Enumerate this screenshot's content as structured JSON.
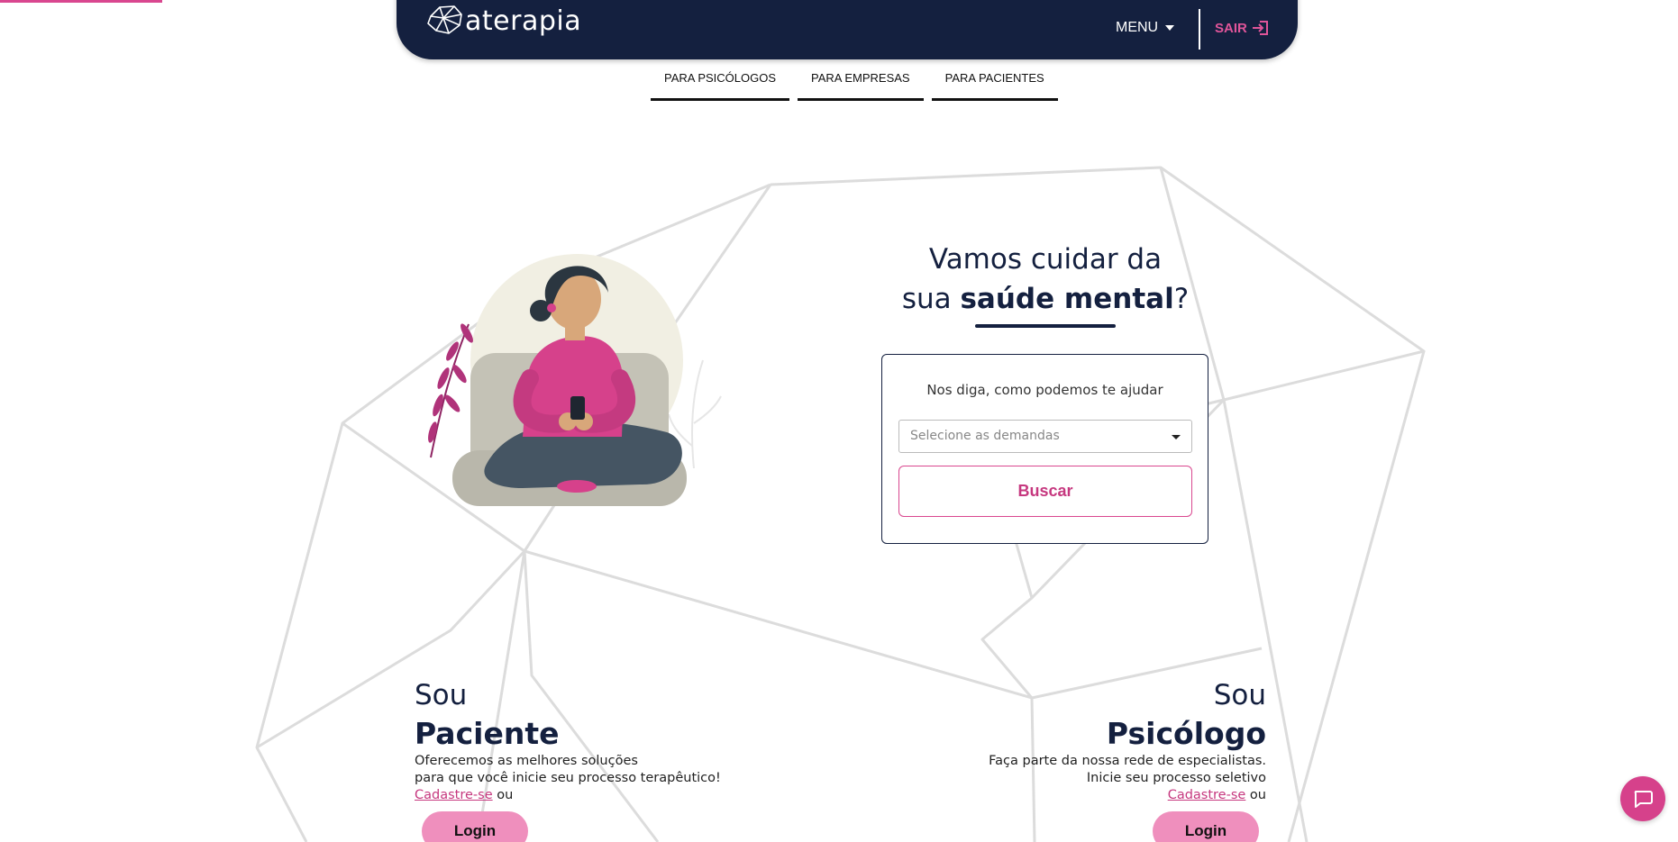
{
  "header": {
    "logo_text": "aterapia",
    "menu_label": "MENU",
    "logout_label": "SAIR"
  },
  "tabs": [
    {
      "label": "PARA PSICÓLOGOS"
    },
    {
      "label": "PARA EMPRESAS"
    },
    {
      "label": "PARA PACIENTES"
    }
  ],
  "hero": {
    "title_line1": "Vamos cuidar da",
    "title_line2_prefix": "sua ",
    "title_line2_bold": "saúde mental",
    "title_line2_suffix": "?"
  },
  "search": {
    "prompt": "Nos diga, como podemos te ajudar",
    "select_placeholder": "Selecione as demandas",
    "button_label": "Buscar"
  },
  "paciente": {
    "sou": "Sou",
    "role": "Paciente",
    "desc_line1": "Oferecemos as melhores soluções",
    "desc_line2": "para que você inicie seu processo terapêutico!",
    "signup_link": "Cadastre-se",
    "or_text": " ou",
    "login_label": "Login"
  },
  "psicologo": {
    "sou": "Sou",
    "role": "Psicólogo",
    "desc_line1": "Faça parte da nossa rede de especialistas.",
    "desc_line2": "Inicie seu processo seletivo",
    "signup_link": "Cadastre-se",
    "or_text": " ou",
    "login_label": "Login"
  },
  "colors": {
    "navy": "#14203f",
    "pink": "#d9478f",
    "pink_light": "#ef8fbd"
  },
  "icons": {
    "logo": "geometric-brain-logo-icon",
    "menu": "caret-down-icon",
    "logout": "sign-out-icon",
    "chat": "chat-bubble-icon"
  }
}
